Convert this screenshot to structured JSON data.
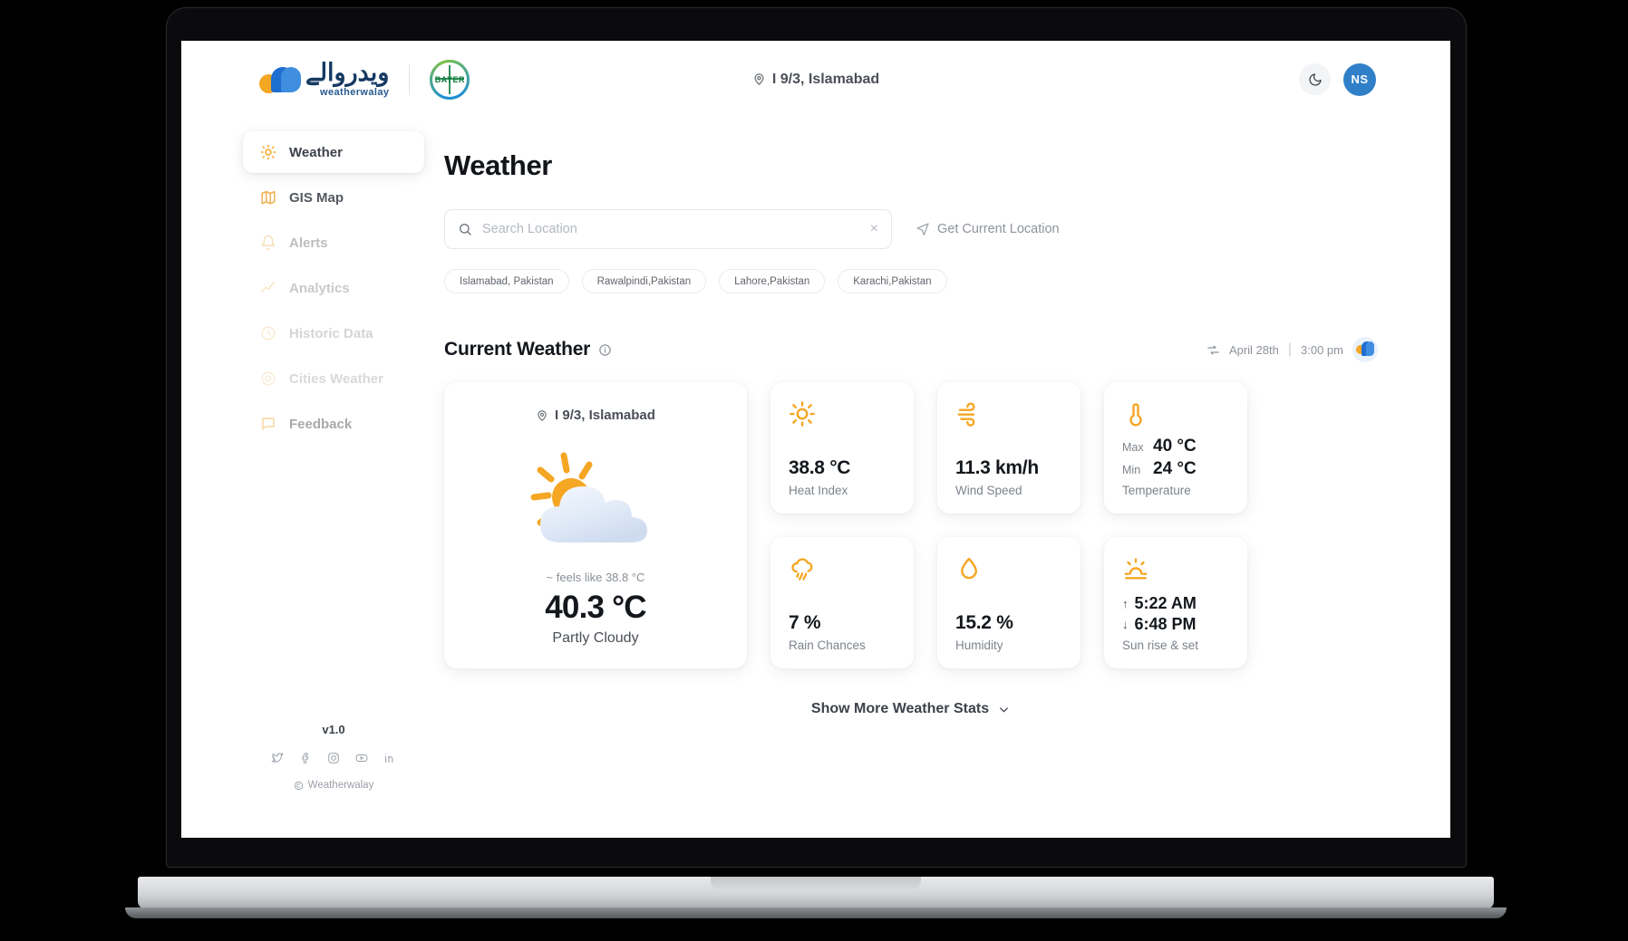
{
  "brand": {
    "urdu_name": "ويدروالے",
    "latin_name": "weatherwalay",
    "partner_badge": "BAYER"
  },
  "header": {
    "location": "I 9/3, Islamabad",
    "theme_toggle_icon": "moon-icon",
    "avatar_initials": "NS"
  },
  "sidebar": {
    "items": [
      {
        "label": "Weather",
        "icon": "sun-icon",
        "active": true,
        "dim": ""
      },
      {
        "label": "GIS Map",
        "icon": "map-icon",
        "active": false,
        "dim": "o85"
      },
      {
        "label": "Alerts",
        "icon": "bell-icon",
        "active": false,
        "dim": "o40"
      },
      {
        "label": "Analytics",
        "icon": "chart-line-icon",
        "active": false,
        "dim": "o30"
      },
      {
        "label": "Historic Data",
        "icon": "clock-icon",
        "active": false,
        "dim": "o25"
      },
      {
        "label": "Cities Weather",
        "icon": "target-icon",
        "active": false,
        "dim": "o20"
      },
      {
        "label": "Feedback",
        "icon": "chat-icon",
        "active": false,
        "dim": "o55"
      }
    ],
    "version": "v1.0",
    "socials": [
      "twitter-icon",
      "facebook-icon",
      "instagram-icon",
      "youtube-icon",
      "linkedin-icon"
    ],
    "copyright": "Weatherwalay"
  },
  "main": {
    "page_title": "Weather",
    "search": {
      "placeholder": "Search Location",
      "value": "",
      "clear_label": "×",
      "search_icon": "search-icon"
    },
    "get_current_location": "Get Current Location",
    "chips": [
      "Islamabad, Pakistan",
      "Rawalpindi,Pakistan",
      "Lahore,Pakistan",
      "Karachi,Pakistan"
    ],
    "section": {
      "title": "Current Weather",
      "info_icon": "info-icon",
      "refresh_icon": "refresh-icon",
      "timestamp_date": "April 28th",
      "timestamp_sep": "|",
      "timestamp_time": "3:00 pm"
    },
    "hero": {
      "location": "I 9/3, Islamabad",
      "icon": "sun-behind-cloud-icon",
      "feels_like": "~ feels like 38.8 °C",
      "temperature": "40.3 °C",
      "condition": "Partly Cloudy"
    },
    "stats": [
      {
        "icon": "sun-icon",
        "value": "38.8 °C",
        "label": "Heat Index"
      },
      {
        "icon": "wind-icon",
        "value": "11.3 km/h",
        "label": "Wind Speed"
      },
      {
        "icon": "rain-cloud-icon",
        "value": "7 %",
        "label": "Rain Chances"
      },
      {
        "icon": "droplet-icon",
        "value": "15.2 %",
        "label": "Humidity"
      }
    ],
    "temperature_card": {
      "icon": "thermometer-icon",
      "max_key": "Max",
      "max_value": "40 °C",
      "min_key": "Min",
      "min_value": "24 °C",
      "label": "Temperature"
    },
    "sun_card": {
      "icon": "sunrise-icon",
      "rise_arrow": "↑",
      "rise_value": "5:22 AM",
      "set_arrow": "↓",
      "set_value": "6:48 PM",
      "label": "Sun rise & set"
    },
    "show_more": "Show More Weather Stats",
    "show_more_icon": "chevron-down-icon"
  },
  "colors": {
    "accent_orange": "#f5a623",
    "brand_blue": "#1f6fd0",
    "avatar_blue": "#2f80c8",
    "text_dark": "#14181d",
    "text_muted": "#7d838b"
  }
}
